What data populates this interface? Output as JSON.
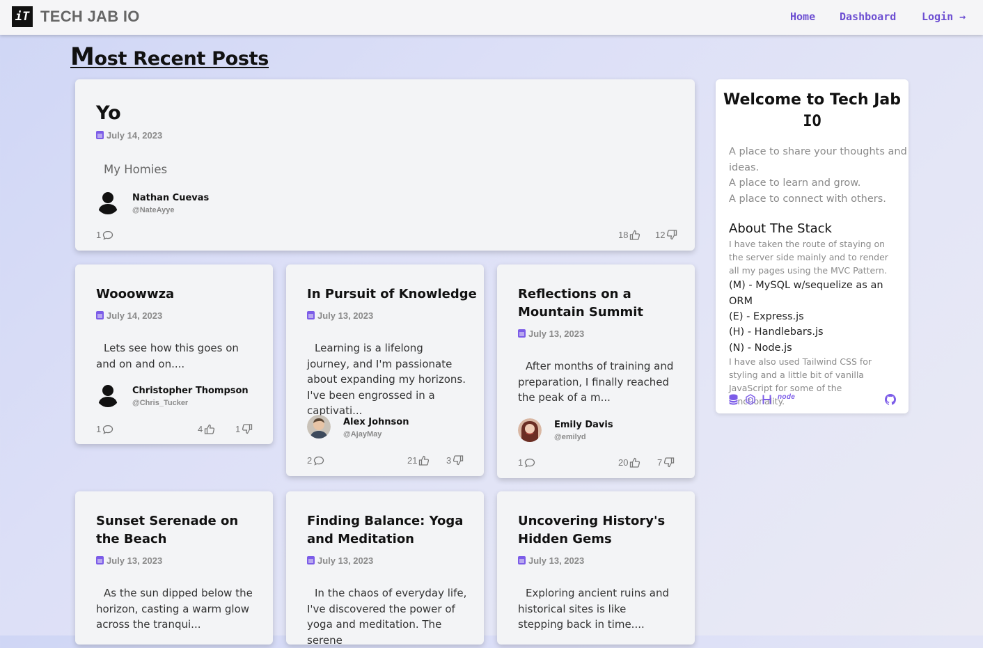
{
  "header": {
    "logo_text": "iT",
    "brand": "TECH JAB IO",
    "nav": {
      "home": "Home",
      "dashboard": "Dashboard",
      "login": "Login →"
    }
  },
  "page_title": {
    "first_letter": "M",
    "rest": "ost Recent Posts"
  },
  "posts": [
    {
      "title": "Yo",
      "date": "July 14, 2023",
      "body": "My Homies",
      "author": "Nathan Cuevas",
      "handle": "@NateAyye",
      "comments": "1",
      "likes": "18",
      "dislikes": "12"
    },
    {
      "title": "Wooowwza",
      "date": "July 14, 2023",
      "body": "Lets see how this goes on and on and on....",
      "author": "Christopher Thompson",
      "handle": "@Chris_Tucker",
      "comments": "1",
      "likes": "4",
      "dislikes": "1"
    },
    {
      "title": "In Pursuit of Knowledge",
      "date": "July 13, 2023",
      "body": "Learning is a lifelong journey, and I'm passionate about expanding my horizons. I've been engrossed in a captivati...",
      "author": "Alex Johnson",
      "handle": "@AjayMay",
      "comments": "2",
      "likes": "21",
      "dislikes": "3"
    },
    {
      "title": "Reflections on a Mountain Summit",
      "date": "July 13, 2023",
      "body": "After months of training and preparation, I finally reached the peak of a m...",
      "author": "Emily Davis",
      "handle": "@emilyd",
      "comments": "1",
      "likes": "20",
      "dislikes": "7"
    },
    {
      "title": "Sunset Serenade on the Beach",
      "date": "July 13, 2023",
      "body": "As the sun dipped below the horizon, casting a warm glow across the tranqui..."
    },
    {
      "title": "Finding Balance: Yoga and Meditation",
      "date": "July 13, 2023",
      "body": "In the chaos of everyday life, I've discovered the power of yoga and meditation. The serene"
    },
    {
      "title": "Uncovering History's Hidden Gems",
      "date": "July 13, 2023",
      "body": "Exploring ancient ruins and historical sites is like stepping back in time...."
    }
  ],
  "sidebar": {
    "title_line1": "Welcome to Tech Jab",
    "title_line2": "IO",
    "taglines": [
      "A place to share your thoughts and",
      "ideas.",
      "A place to learn and grow.",
      "A place to connect with others."
    ],
    "about_heading": "About The Stack",
    "about_text": "I have taken the route of staying on the server side mainly and to render all my pages using the MVC Pattern.",
    "stack": [
      "(M) - MySQL w/sequelize as an ORM",
      "(E) - Express.js",
      "(H) - Handlebars.js",
      "(N) - Node.js"
    ],
    "extra_text": "I have also used Tailwind CSS for styling and a little bit of vanilla JavaScript for some of the functionality.",
    "node_label": "node",
    "icons": [
      "database-icon",
      "sequelize-icon",
      "handlebars-icon",
      "node-icon",
      "github-icon"
    ]
  },
  "colors": {
    "accent": "#7c5ce8",
    "nav": "#6d4fd2"
  }
}
